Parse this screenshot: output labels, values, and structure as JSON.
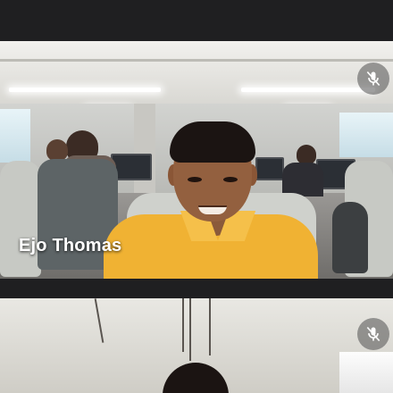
{
  "tiles": [
    {
      "participant_name": "Ejo Thomas",
      "mic_status_icon": "mic-off-icon"
    },
    {
      "participant_name": "",
      "mic_status_icon": "mic-off-icon"
    }
  ],
  "colors": {
    "background": "#1f1f21",
    "name_text": "#ffffff",
    "mic_button_bg": "#505050"
  }
}
